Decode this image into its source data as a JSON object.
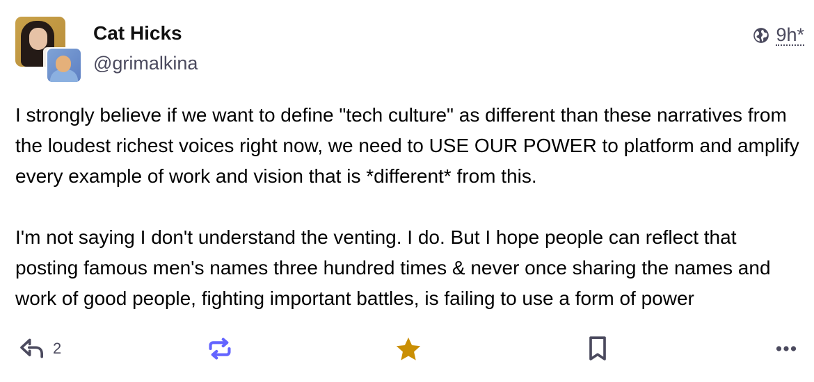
{
  "author": {
    "display_name": "Cat Hicks",
    "handle": "@grimalkina"
  },
  "meta": {
    "visibility_icon": "globe-icon",
    "relative_time": "9h",
    "edited_marker": "*"
  },
  "content": {
    "paragraphs": [
      "I strongly believe if we want to define \"tech culture\" as different than these narratives from the loudest richest voices right now, we need to USE OUR POWER to platform and amplify every example of work and vision that is *different* from this.",
      "I'm not saying I don't understand the venting. I do. But I hope people can reflect that posting famous men's names three hundred times & never once sharing the names and work of good people, fighting important battles, is failing to use a form of power"
    ]
  },
  "actions": {
    "reply": {
      "icon": "reply-icon",
      "count": "2"
    },
    "boost": {
      "icon": "boost-icon",
      "color": "#6364ff"
    },
    "favourite": {
      "icon": "star-icon",
      "color": "#ca8f04",
      "active": true
    },
    "bookmark": {
      "icon": "bookmark-icon"
    },
    "more": {
      "icon": "more-icon"
    }
  },
  "colors": {
    "text": "#000000",
    "secondary": "#4b4a5e",
    "boost": "#6364ff",
    "favourite": "#ca8f04"
  }
}
